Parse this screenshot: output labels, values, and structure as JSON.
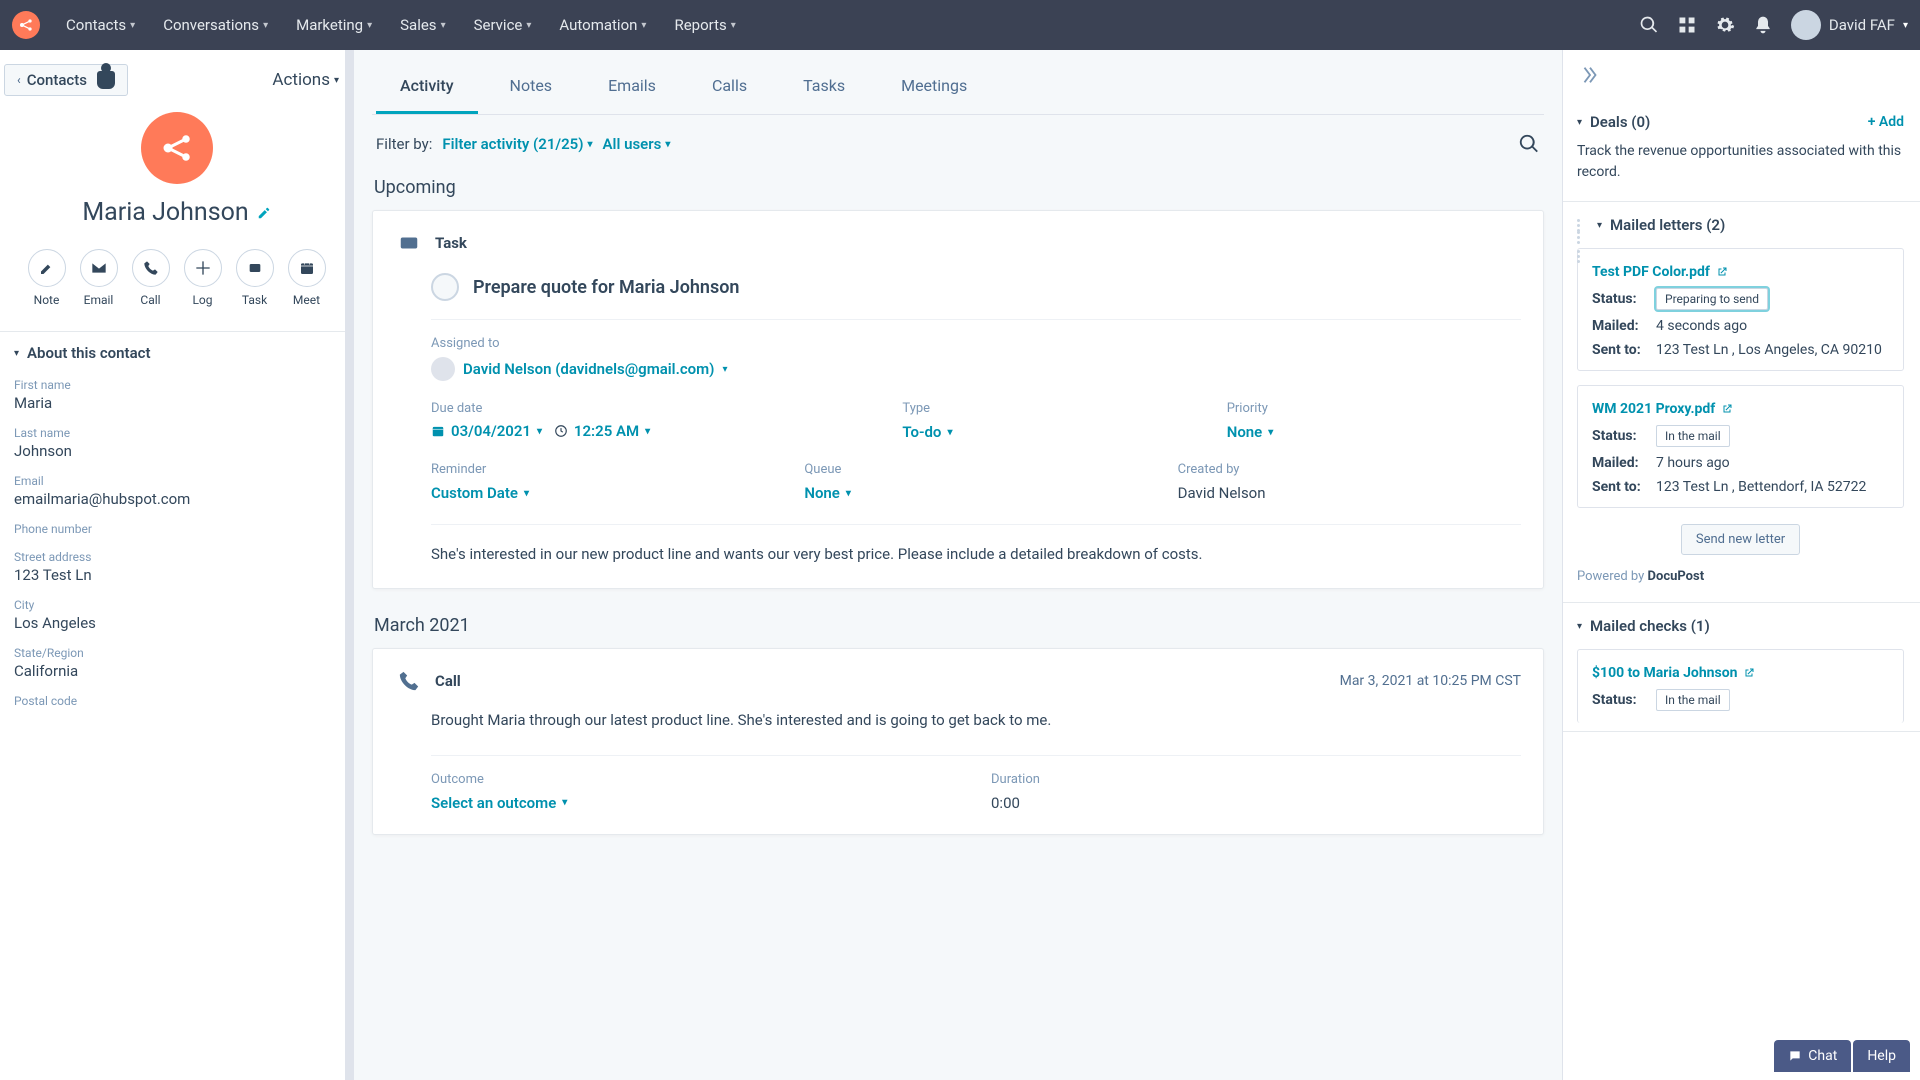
{
  "nav": {
    "items": [
      "Contacts",
      "Conversations",
      "Marketing",
      "Sales",
      "Service",
      "Automation",
      "Reports"
    ],
    "user": "David FAF"
  },
  "left": {
    "back": "Contacts",
    "actions": "Actions",
    "name": "Maria Johnson",
    "quick": [
      {
        "label": "Note"
      },
      {
        "label": "Email"
      },
      {
        "label": "Call"
      },
      {
        "label": "Log"
      },
      {
        "label": "Task"
      },
      {
        "label": "Meet"
      }
    ],
    "about_title": "About this contact",
    "fields": {
      "first_name": {
        "label": "First name",
        "value": "Maria"
      },
      "last_name": {
        "label": "Last name",
        "value": "Johnson"
      },
      "email": {
        "label": "Email",
        "value": "emailmaria@hubspot.com"
      },
      "phone": {
        "label": "Phone number",
        "value": ""
      },
      "street": {
        "label": "Street address",
        "value": "123 Test Ln"
      },
      "city": {
        "label": "City",
        "value": "Los Angeles"
      },
      "state": {
        "label": "State/Region",
        "value": "California"
      },
      "postal": {
        "label": "Postal code",
        "value": ""
      }
    }
  },
  "center": {
    "tabs": [
      "Activity",
      "Notes",
      "Emails",
      "Calls",
      "Tasks",
      "Meetings"
    ],
    "filter_label": "Filter by:",
    "filter_activity": "Filter activity (21/25)",
    "filter_users": "All users",
    "upcoming_title": "Upcoming",
    "task": {
      "type_label": "Task",
      "title": "Prepare quote for Maria Johnson",
      "assigned_label": "Assigned to",
      "assignee": "David Nelson (davidnels@gmail.com)",
      "due_label": "Due date",
      "due_date": "03/04/2021",
      "due_time": "12:25 AM",
      "type_l": "Type",
      "type_v": "To-do",
      "priority_l": "Priority",
      "priority_v": "None",
      "reminder_l": "Reminder",
      "reminder_v": "Custom Date",
      "queue_l": "Queue",
      "queue_v": "None",
      "created_l": "Created by",
      "created_v": "David Nelson",
      "desc": "She's interested in our new product line and wants our very best price. Please include a detailed breakdown of costs."
    },
    "month_title": "March 2021",
    "call": {
      "type_label": "Call",
      "time": "Mar 3, 2021 at 10:25 PM CST",
      "body": "Brought Maria through our latest product line. She's interested and is going to get back to me.",
      "outcome_l": "Outcome",
      "outcome_v": "Select an outcome",
      "duration_l": "Duration",
      "duration_v": "0:00"
    }
  },
  "right": {
    "deals": {
      "title": "Deals (0)",
      "add": "+ Add",
      "body": "Track the revenue opportunities associated with this record."
    },
    "letters": {
      "title": "Mailed letters (2)",
      "items": [
        {
          "name": "Test PDF Color.pdf",
          "status": "Preparing to send",
          "mailed": "4 seconds ago",
          "sent_to": "123 Test Ln , Los Angeles, CA 90210",
          "prep": true
        },
        {
          "name": "WM 2021 Proxy.pdf",
          "status": "In the mail",
          "mailed": "7 hours ago",
          "sent_to": "123 Test Ln , Bettendorf, IA 52722",
          "prep": false
        }
      ],
      "kv": {
        "status": "Status:",
        "mailed": "Mailed:",
        "sent": "Sent to:"
      },
      "send_new": "Send new letter",
      "powered_prefix": "Powered by ",
      "powered_name": "DocuPost"
    },
    "checks": {
      "title": "Mailed checks (1)",
      "item_name": "$100 to Maria Johnson",
      "status_l": "Status:",
      "status_v": "In the mail"
    }
  },
  "footer": {
    "chat": "Chat",
    "help": "Help"
  }
}
